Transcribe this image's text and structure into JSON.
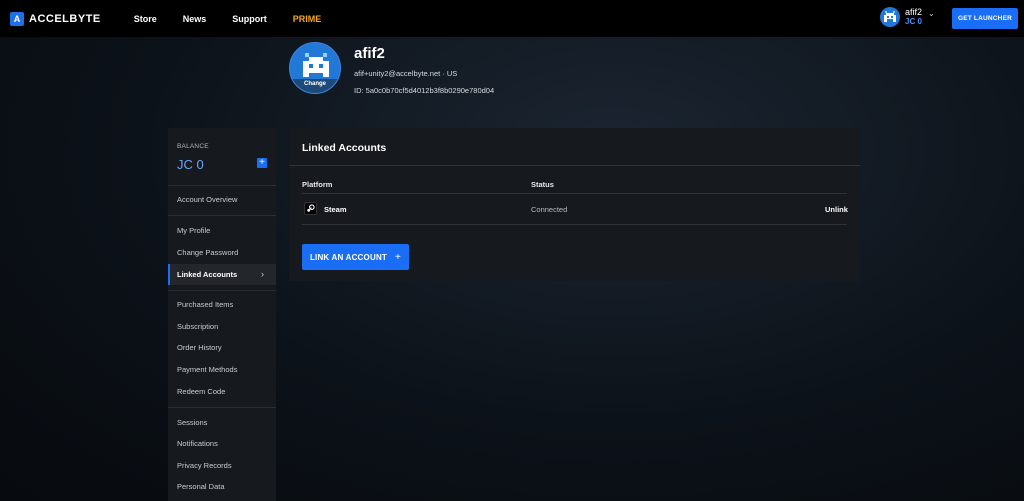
{
  "header": {
    "logo_text": "ACCELBYTE",
    "nav": [
      {
        "label": "Store"
      },
      {
        "label": "News"
      },
      {
        "label": "Support"
      },
      {
        "label": "PRIME"
      }
    ],
    "user": {
      "name": "afif2",
      "balance": "JC 0"
    },
    "launcher_label": "GET LAUNCHER"
  },
  "profile": {
    "name": "afif2",
    "email": "afif+unity2@accelbyte.net · US",
    "id": "ID: 5a0c0b70cf5d4012b3f8b0290e780d04",
    "avatar_change_label": "Change"
  },
  "sidebar": {
    "balance_label": "BALANCE",
    "balance_value": "JC 0",
    "items": [
      {
        "label": "Account Overview"
      },
      {
        "label": "My Profile"
      },
      {
        "label": "Change Password"
      },
      {
        "label": "Linked Accounts"
      },
      {
        "label": "Purchased Items"
      },
      {
        "label": "Subscription"
      },
      {
        "label": "Order History"
      },
      {
        "label": "Payment Methods"
      },
      {
        "label": "Redeem Code"
      },
      {
        "label": "Sessions"
      },
      {
        "label": "Notifications"
      },
      {
        "label": "Privacy Records"
      },
      {
        "label": "Personal Data"
      }
    ]
  },
  "linked": {
    "title": "Linked Accounts",
    "col_platform": "Platform",
    "col_status": "Status",
    "rows": [
      {
        "platform": "Steam",
        "status": "Connected",
        "action": "Unlink"
      }
    ],
    "link_button": "LINK AN ACCOUNT"
  },
  "colors": {
    "accent": "#1a6ef5",
    "prime": "#f5a623"
  }
}
